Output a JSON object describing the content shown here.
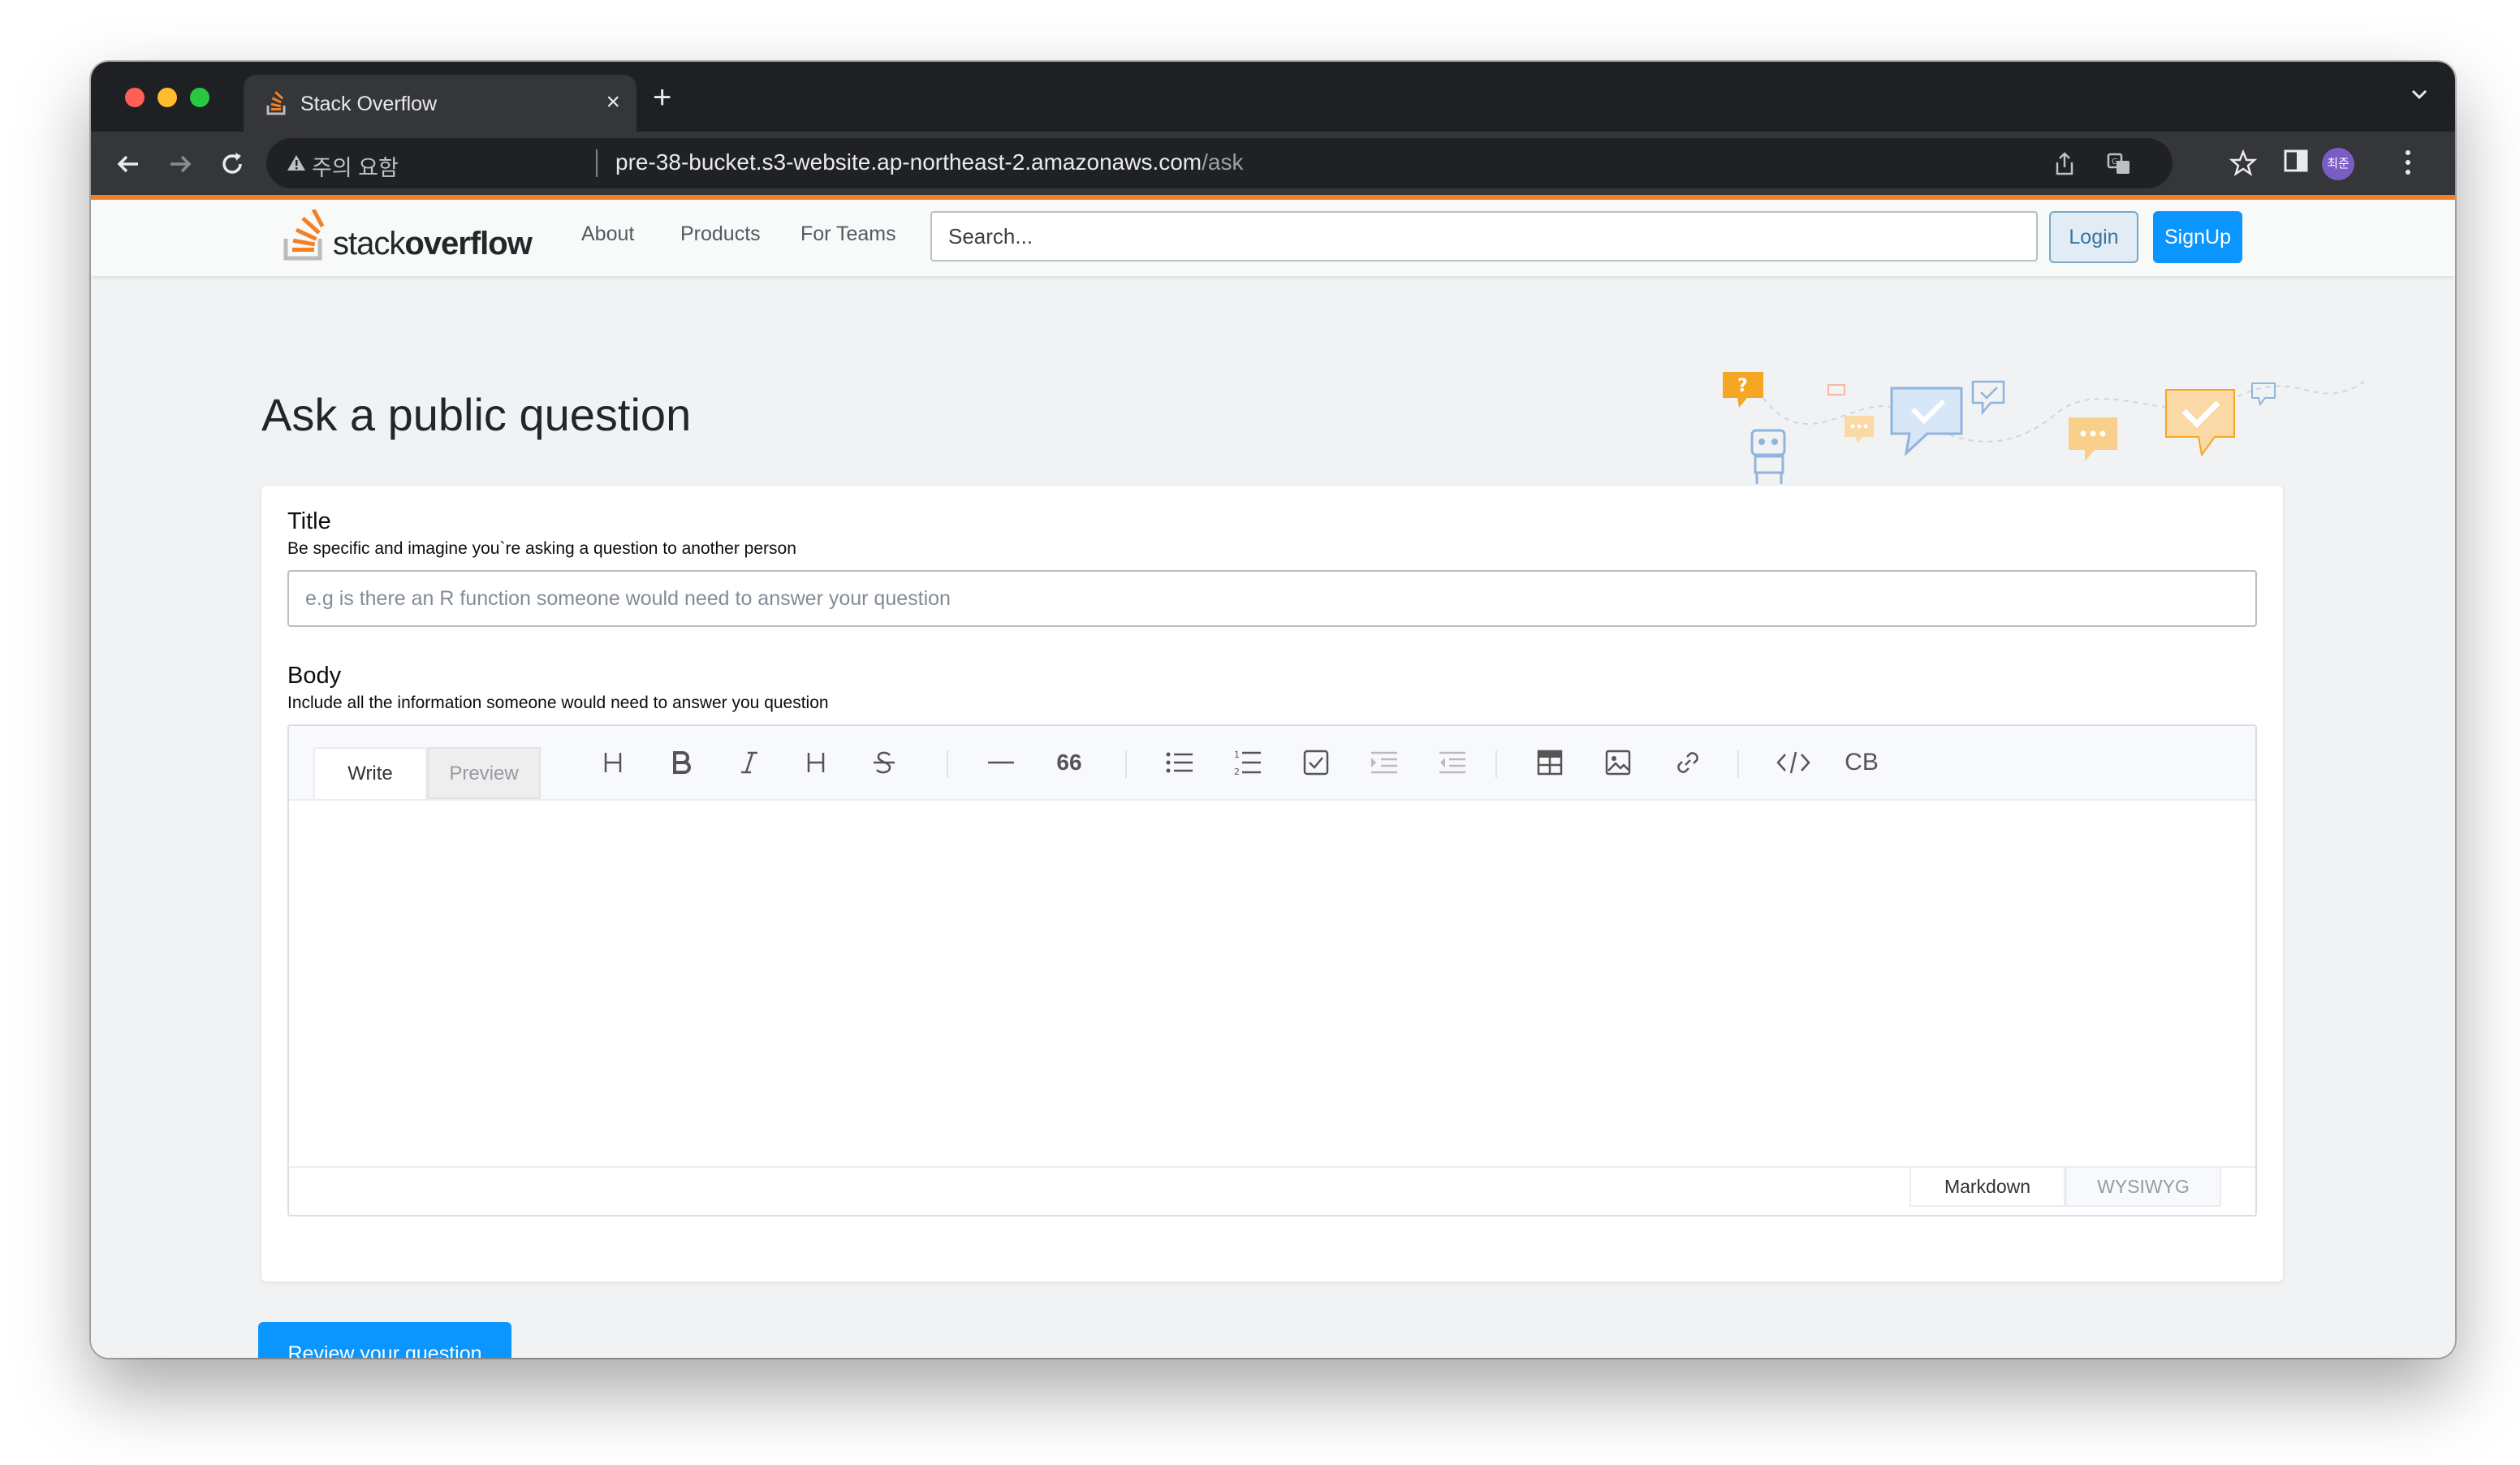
{
  "browser": {
    "tab_title": "Stack Overflow",
    "tab_close": "×",
    "new_tab": "+",
    "security_warning": "주의 요함",
    "url_host": "pre-38-bucket.s3-website.ap-northeast-2.amazonaws.com",
    "url_path": "/ask",
    "profile_initials": "최준"
  },
  "header": {
    "logo_light": "stack",
    "logo_bold": "overflow",
    "nav": [
      "About",
      "Products",
      "For Teams"
    ],
    "search_placeholder": "Search...",
    "login_label": "Login",
    "signup_label": "SignUp",
    "accent_color": "#f48024"
  },
  "main": {
    "page_title": "Ask a public question",
    "title_section": {
      "label": "Title",
      "hint": "Be specific and imagine you`re asking a question to another person",
      "placeholder": "e.g is there an R function someone would need to answer your question"
    },
    "body_section": {
      "label": "Body",
      "hint": "Include all the information someone would need to answer you question"
    },
    "editor": {
      "tabs": [
        "Write",
        "Preview"
      ],
      "active_tab": "Write",
      "toolbar_icons": [
        "heading-icon",
        "bold-icon",
        "italic-icon",
        "heading-alt-icon",
        "strikethrough-icon",
        "horizontal-rule-icon",
        "quote-icon",
        "bullet-list-icon",
        "ordered-list-icon",
        "task-list-icon",
        "indent-icon",
        "outdent-icon",
        "table-icon",
        "image-icon",
        "link-icon",
        "code-icon",
        "code-block-icon"
      ],
      "quote_glyph": "66",
      "code_block_label": "CB",
      "modes": [
        "Markdown",
        "WYSIWYG"
      ],
      "active_mode": "Markdown"
    },
    "review_button": "Review your question",
    "primary_color": "#0a95ff"
  }
}
